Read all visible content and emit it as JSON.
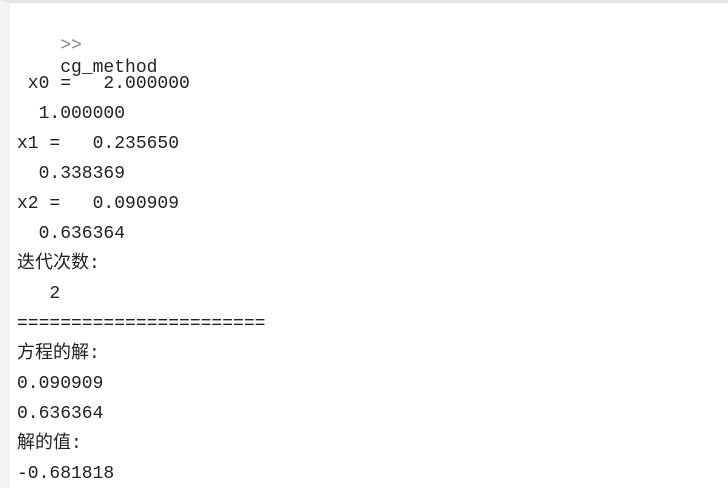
{
  "console": {
    "prompt": {
      "symbol": ">>",
      "command": "cg_method"
    },
    "output": [
      " x0 =   2.000000",
      "  1.000000",
      "x1 =   0.235650",
      "  0.338369",
      "x2 =   0.090909",
      "  0.636364",
      "迭代次数:",
      "   2",
      "=======================",
      "方程的解:",
      "0.090909",
      "0.636364",
      "解的值:",
      "-0.681818"
    ]
  },
  "colors": {
    "text": "#222222",
    "prompt": "#8a8a8a",
    "background": "#ffffff",
    "gutter": "#f3f3f3"
  }
}
